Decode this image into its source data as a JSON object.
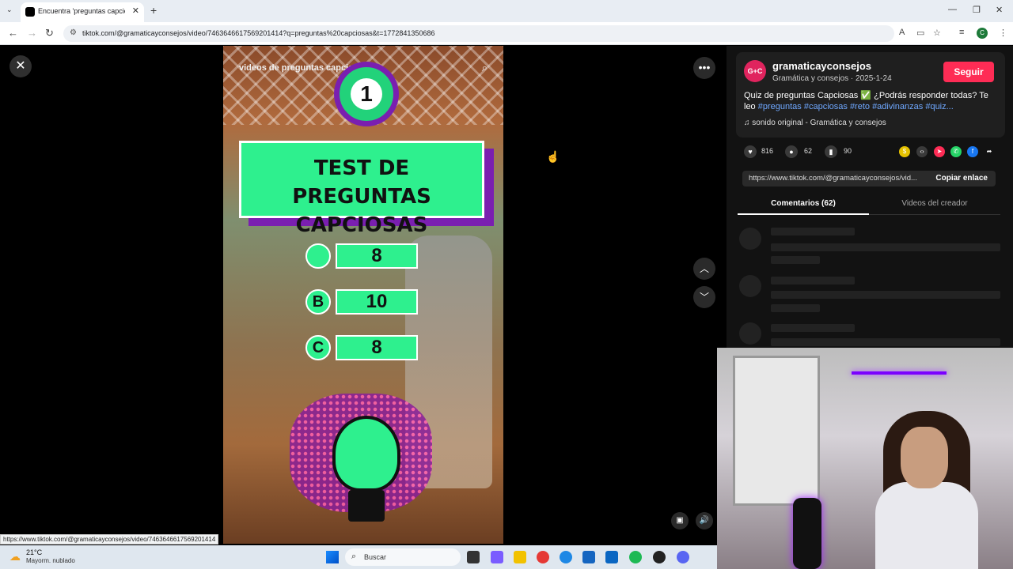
{
  "browser": {
    "tab_title": "Encuentra 'preguntas capciosas'",
    "url": "tiktok.com/@gramaticayconsejos/video/7463646617569201414?q=preguntas%20capciosas&t=1772841350686",
    "status_url": "https://www.tiktok.com/@gramaticayconsejos/video/7463646617569201414",
    "profile_initial": "C"
  },
  "video": {
    "caption": "videos de preguntas capciosas",
    "badge_number": "1",
    "title": "TEST DE PREGUNTAS CAPCIOSAS",
    "options": [
      {
        "letter": "",
        "value": "8"
      },
      {
        "letter": "B",
        "value": "10"
      },
      {
        "letter": "C",
        "value": "8"
      }
    ]
  },
  "author": {
    "avatar_text": "G+C",
    "name": "gramaticayconsejos",
    "subtitle": "Gramática y consejos · 2025-1-24",
    "follow_label": "Seguir"
  },
  "post": {
    "description_text": "Quiz de preguntas Capciosas ✅ ¿Podrás responder todas? Te leo",
    "hashtags": "#preguntas #capciosas #reto #adivinanzas #quiz...",
    "sound": "sonido original - Gramática y consejos",
    "likes": "816",
    "comments": "62",
    "saves": "90",
    "share_link": "https://www.tiktok.com/@gramaticayconsejos/vid...",
    "copy_label": "Copiar enlace"
  },
  "tabs": {
    "comments": "Comentarios (62)",
    "creator_videos": "Videos del creador"
  },
  "taskbar": {
    "weather_temp": "21°C",
    "weather_desc": "Mayorm. nublado",
    "search_placeholder": "Buscar"
  },
  "colors": {
    "accent": "#fe2c55",
    "hashtag": "#6fa8ff",
    "quiz_green": "#2ef08e",
    "quiz_purple": "#7a1fb0"
  }
}
